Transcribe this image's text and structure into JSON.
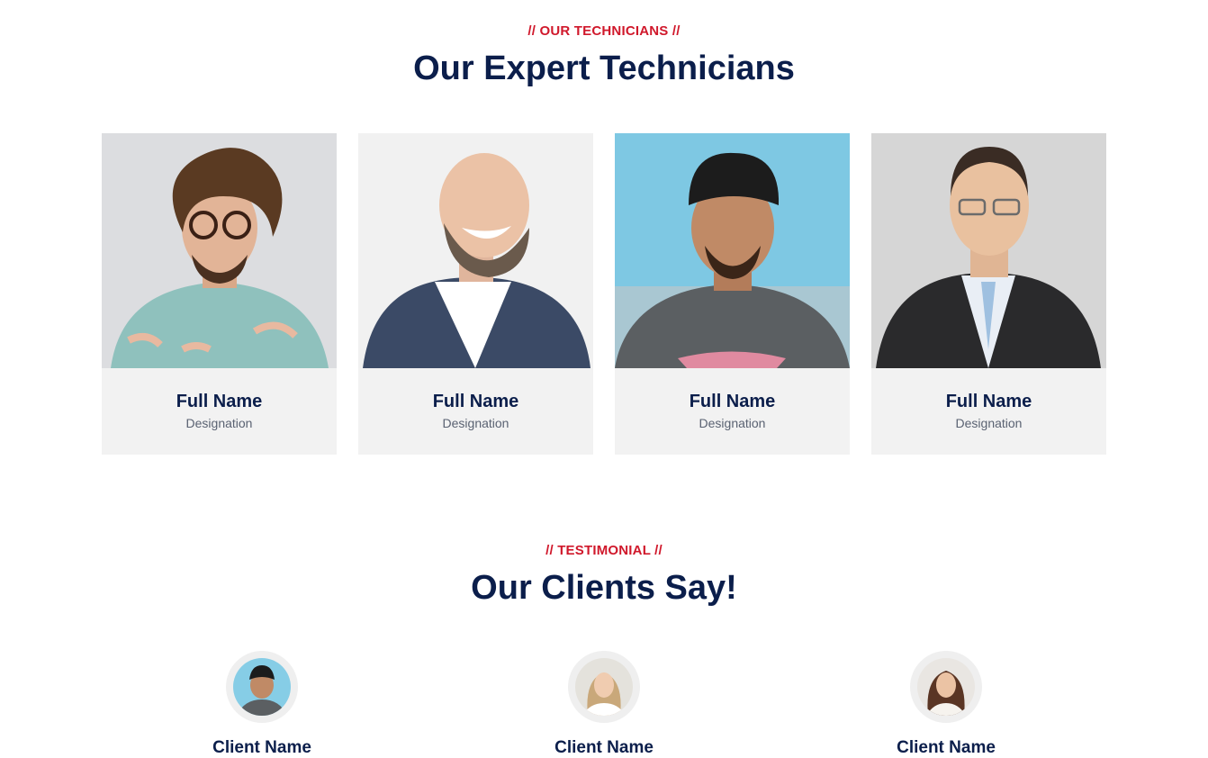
{
  "team_section": {
    "subtitle": "// OUR TECHNICIANS //",
    "title": "Our Expert Technicians",
    "members": [
      {
        "name": "Full Name",
        "designation": "Designation"
      },
      {
        "name": "Full Name",
        "designation": "Designation"
      },
      {
        "name": "Full Name",
        "designation": "Designation"
      },
      {
        "name": "Full Name",
        "designation": "Designation"
      }
    ]
  },
  "testimonial_section": {
    "subtitle": "// TESTIMONIAL //",
    "title": "Our Clients Say!",
    "clients": [
      {
        "name": "Client Name"
      },
      {
        "name": "Client Name"
      },
      {
        "name": "Client Name"
      }
    ]
  },
  "colors": {
    "accent_red": "#d0182b",
    "heading_navy": "#0b1e4b",
    "card_bg": "#f2f2f2"
  }
}
